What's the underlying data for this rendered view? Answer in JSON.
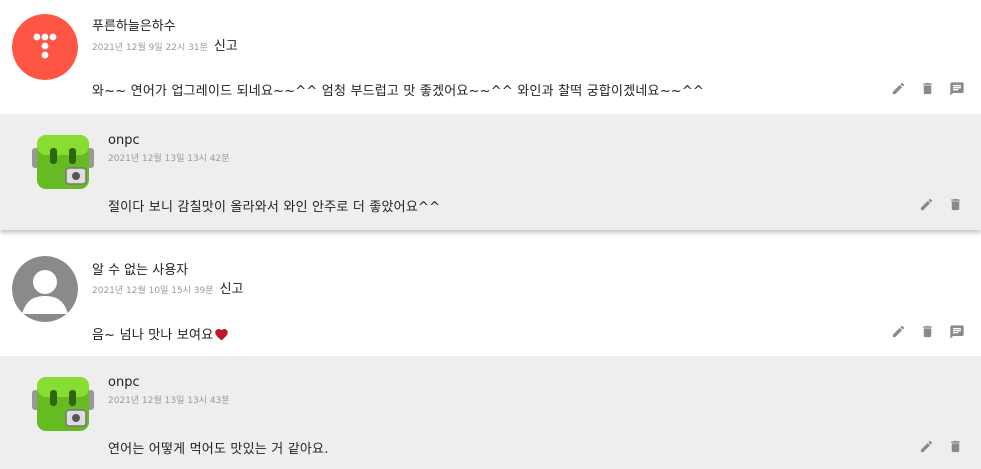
{
  "comments": [
    {
      "author": "푸른하늘은하수",
      "date": "2021년 12월 9일 22시 31분",
      "report_label": "신고",
      "text": "와~~ 연어가 업그레이드 되네요~~^^ 엄청 부드럽고 맛 좋겠어요~~^^ 와인과 찰떡 궁합이겠네요~~^^",
      "avatar": "tistory-logo-red",
      "reply": {
        "author": "onpc",
        "date": "2021년 12월 13일 13시 42분",
        "text": "절이다 보니 감칠맛이 올라와서 와인 안주로 더 좋았어요^^",
        "avatar": "green-robot-icon"
      }
    },
    {
      "author": "알 수 없는 사용자",
      "date": "2021년 12월 10일 15시 39분",
      "report_label": "신고",
      "text": "음~ 넘나 맛나 보여요",
      "text_emoji": "heart-icon",
      "avatar": "default-user-gray",
      "reply": {
        "author": "onpc",
        "date": "2021년 12월 13일 13시 43분",
        "text": "연어는 어떻게 먹어도 맛있는 거 같아요.",
        "avatar": "green-robot-icon"
      }
    }
  ],
  "colors": {
    "reply_bg": "#eeeeee",
    "tistory_red": "#ff5544",
    "robot_green": "#66bb22",
    "default_avatar": "#8a8a8a",
    "action_icon": "#8a8a8a",
    "heart": "#c0182a"
  },
  "icons": [
    "edit-icon",
    "delete-icon",
    "reply-icon"
  ]
}
